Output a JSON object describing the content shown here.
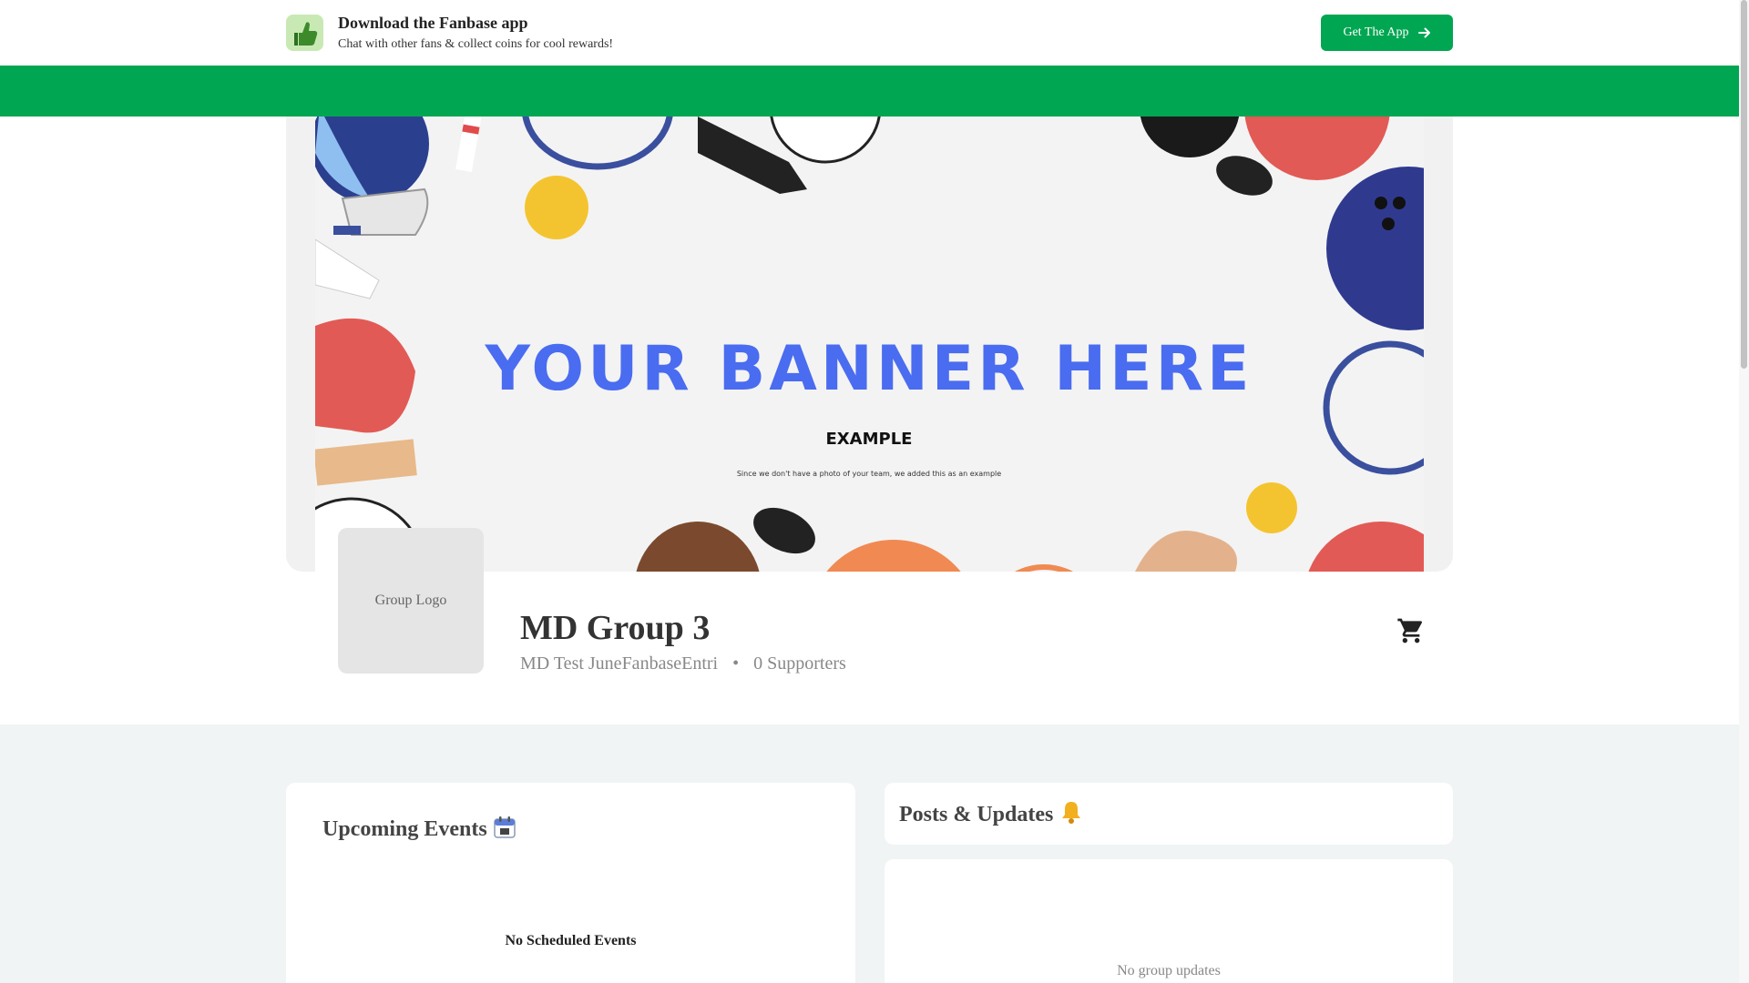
{
  "app_banner": {
    "title": "Download the Fanbase app",
    "subtitle": "Chat with other fans & collect coins for cool rewards!",
    "button_label": "Get The App",
    "icon": "thumbs-up-icon"
  },
  "banner": {
    "headline": "YOUR BANNER HERE",
    "tag": "EXAMPLE",
    "caption": "Since we don't have a photo of your team, we added this as an example"
  },
  "group": {
    "logo_placeholder": "Group Logo",
    "name": "MD Group 3",
    "owner": "MD Test JuneFanbaseEntri",
    "separator": "•",
    "supporters": "0 Supporters"
  },
  "events": {
    "title": "Upcoming Events",
    "icon": "calendar-icon",
    "empty_text": "No Scheduled Events"
  },
  "posts": {
    "title": "Posts & Updates",
    "icon": "bell-icon",
    "empty_text": "No group updates"
  },
  "colors": {
    "brand_green": "#00a651",
    "banner_blue": "#4a6cf0",
    "content_bg": "#f0f4f4"
  }
}
